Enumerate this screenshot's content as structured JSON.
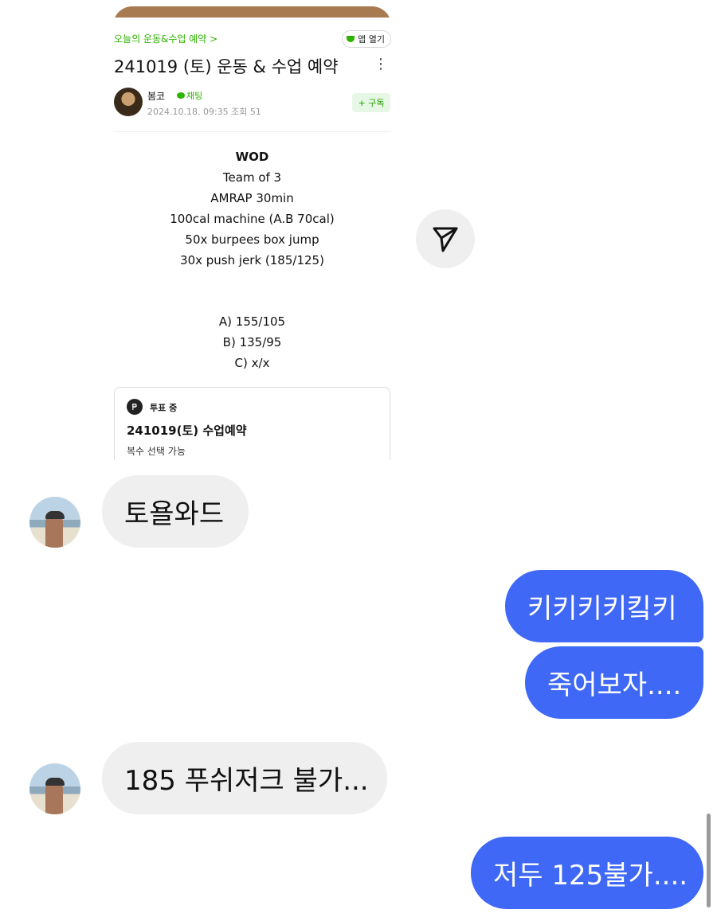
{
  "shared_post": {
    "cafe_link": "오늘의 운동&수업 예약 >",
    "app_open_label": "앱 열기",
    "title": "241019 (토) 운동 & 수업 예약",
    "author": "봄코",
    "chat_label": "채팅",
    "meta": "2024.10.18. 09:35 조회 51",
    "subscribe_label": "+ 구독",
    "wod_lines": [
      "WOD",
      "Team of 3",
      "AMRAP 30min",
      "100cal machine (A.B 70cal)",
      "50x burpees box jump",
      "30x push jerk (185/125)"
    ],
    "scale_lines": [
      "A) 155/105",
      "B) 135/95",
      "C) x/x"
    ],
    "vote": {
      "status": "투표 중",
      "title": "241019(토) 수업예약",
      "sub": "복수 선택 가능"
    }
  },
  "messages": [
    {
      "side": "in",
      "text": "토욜와드"
    },
    {
      "side": "out",
      "text": "키키키키킼키"
    },
    {
      "side": "out",
      "text": "죽어보자...."
    },
    {
      "side": "in",
      "text": "185 푸쉬저크 불가..."
    },
    {
      "side": "out",
      "text": "저두 125불가...."
    }
  ],
  "colors": {
    "outgoing_bubble": "#3e68f5",
    "incoming_bubble": "#efefef",
    "cafe_green": "#2db400"
  },
  "icons": {
    "share": "send-paper-plane-icon",
    "vote": "vote-icon"
  }
}
